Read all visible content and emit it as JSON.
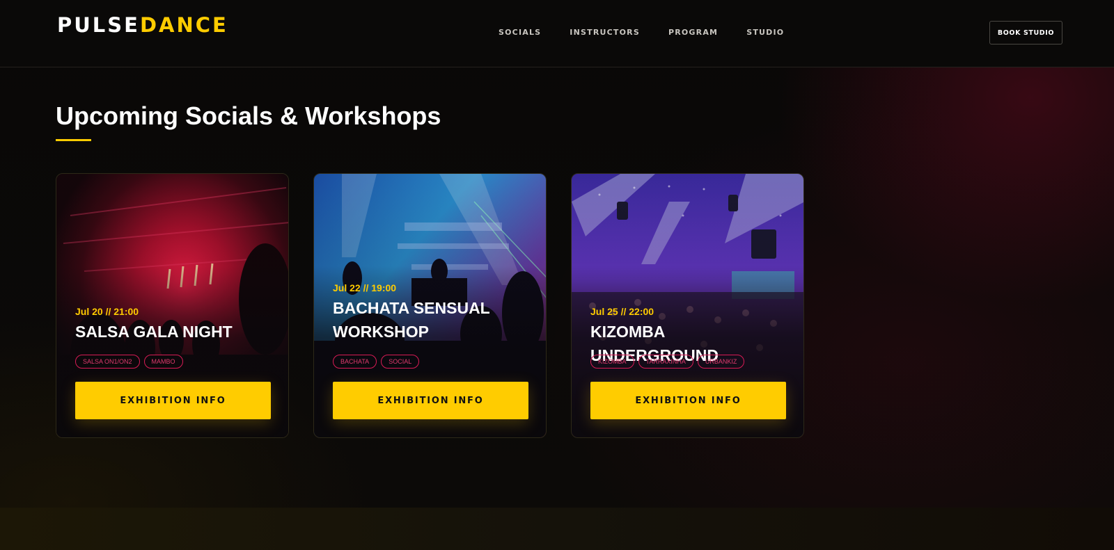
{
  "brand": {
    "part1": "PULSE",
    "part2": "DANCE"
  },
  "nav": [
    "SOCIALS",
    "INSTRUCTORS",
    "PROGRAM",
    "STUDIO"
  ],
  "header_button": "BOOK STUDIO",
  "section_title": "Upcoming Socials & Workshops",
  "colors": {
    "accent": "#ffcc00",
    "tag": "#d81b55",
    "background": "#0a0908"
  },
  "events": [
    {
      "date": "Jul 20 // 21:00",
      "title": "SALSA GALA NIGHT",
      "tags": [
        "SALSA ON1/ON2",
        "MAMBO"
      ],
      "button": "EXHIBITION INFO"
    },
    {
      "date": "Jul 22 // 19:00",
      "title": "BACHATA SENSUAL WORKSHOP",
      "tags": [
        "BACHATA",
        "SOCIAL"
      ],
      "button": "EXHIBITION INFO"
    },
    {
      "date": "Jul 25 // 22:00",
      "title": "KIZOMBA UNDERGROUND",
      "tags": [
        "KIZOMBA",
        "TARRAXINHA",
        "URBANKIZ"
      ],
      "button": "EXHIBITION INFO"
    }
  ]
}
